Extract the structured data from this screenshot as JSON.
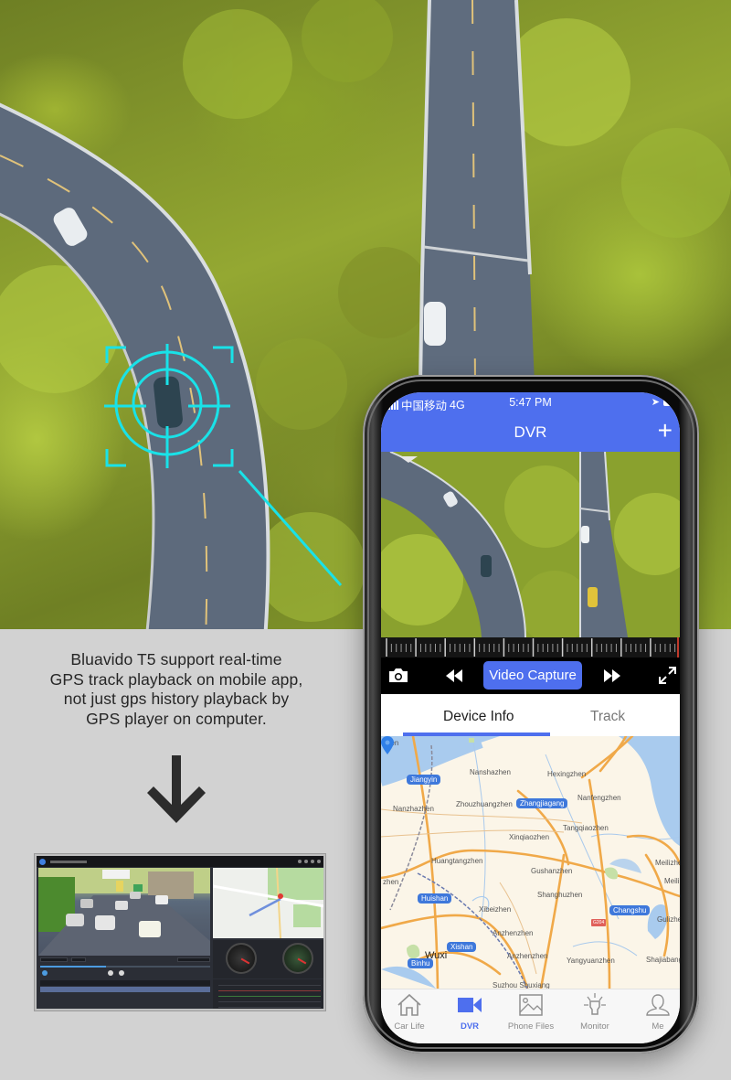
{
  "caption": {
    "lines": [
      "Bluavido T5 support real-time",
      "GPS track playback on mobile app,",
      "not just gps history playback by",
      "GPS player on computer."
    ]
  },
  "icons": {
    "target": "crosshair-target-icon",
    "arrow": "arrow-down-icon",
    "camera": "camera-icon",
    "rewind": "rewind-icon",
    "fast_forward": "fast-forward-icon",
    "fullscreen": "fullscreen-icon",
    "add": "plus-icon",
    "pin": "map-pin-icon"
  },
  "colors": {
    "accent": "#4e6fee",
    "target_cyan": "#19e2e8",
    "background": "#d2d2d2",
    "map_city_label": "#3e78db"
  },
  "phone": {
    "status_bar": {
      "carrier": "中国移动",
      "network": "4G",
      "time": "5:47 PM"
    },
    "nav": {
      "title": "DVR",
      "add_label": "+"
    },
    "controls": {
      "capture_label": "Video Capture"
    },
    "tabs": [
      {
        "label": "Device Info",
        "active": true
      },
      {
        "label": "Track",
        "active": false
      }
    ],
    "map": {
      "places": [
        "zhen",
        "Nanshazhen",
        "Hexingzhen",
        "Nanzhazhen",
        "Zhouzhuangzhen",
        "Nanfengzhen",
        "Tangqiaozhen",
        "Xinqiaozhen",
        "Huangtangzhen",
        "Meilizhen",
        "Gushanzhen",
        "zhen",
        "Shanghuzhen",
        "Meili",
        "Xibeizhen",
        "Gulizhen",
        "Anzhenzhen",
        "Anzhenzhen",
        "Yangyuanzhen",
        "Shajiabang",
        "Suzhou Shuxiang"
      ],
      "cities": [
        "Jiangyin",
        "Zhangjiagang",
        "Huishan",
        "Changshu",
        "Xishan",
        "Binhu"
      ],
      "major_city": "Wuxi",
      "road_shield": "G204"
    },
    "tabbar": [
      {
        "label": "Car Life",
        "icon": "home-icon",
        "active": false
      },
      {
        "label": "DVR",
        "icon": "video-camera-icon",
        "active": true
      },
      {
        "label": "Phone Files",
        "icon": "image-icon",
        "active": false
      },
      {
        "label": "Monitor",
        "icon": "lamp-icon",
        "active": false
      },
      {
        "label": "Me",
        "icon": "user-icon",
        "active": false
      }
    ]
  }
}
